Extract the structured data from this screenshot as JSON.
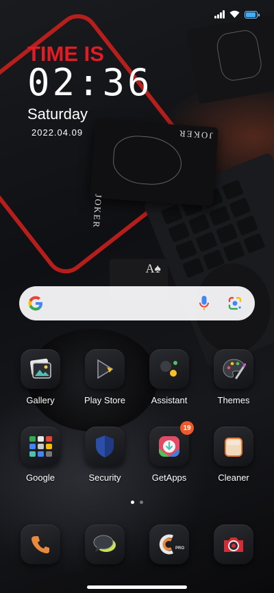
{
  "status_bar": {
    "icons": [
      "signal-icon",
      "wifi-icon",
      "battery-icon"
    ],
    "battery_color": "#3ab0ff"
  },
  "clock_widget": {
    "heading": "TIME IS",
    "time": "02:36",
    "day": "Saturday",
    "date": "2022.04.09",
    "accent_color": "#e11c24"
  },
  "search_bar": {
    "icons": [
      "google-g-icon",
      "microphone-icon",
      "google-lens-icon"
    ]
  },
  "apps_row1": [
    {
      "label": "Gallery",
      "icon": "gallery-icon"
    },
    {
      "label": "Play Store",
      "icon": "play-store-icon"
    },
    {
      "label": "Assistant",
      "icon": "assistant-icon"
    },
    {
      "label": "Themes",
      "icon": "themes-icon"
    }
  ],
  "apps_row2": [
    {
      "label": "Google",
      "icon": "google-folder-icon"
    },
    {
      "label": "Security",
      "icon": "security-shield-icon"
    },
    {
      "label": "GetApps",
      "icon": "getapps-icon",
      "badge": "19"
    },
    {
      "label": "Cleaner",
      "icon": "cleaner-icon"
    }
  ],
  "page_indicator": {
    "pages": 2,
    "current": 1
  },
  "dock": [
    {
      "icon": "phone-icon"
    },
    {
      "icon": "messages-icon"
    },
    {
      "icon": "ccleaner-pro-icon",
      "icon_text": "PRO"
    },
    {
      "icon": "camera-icon"
    }
  ]
}
